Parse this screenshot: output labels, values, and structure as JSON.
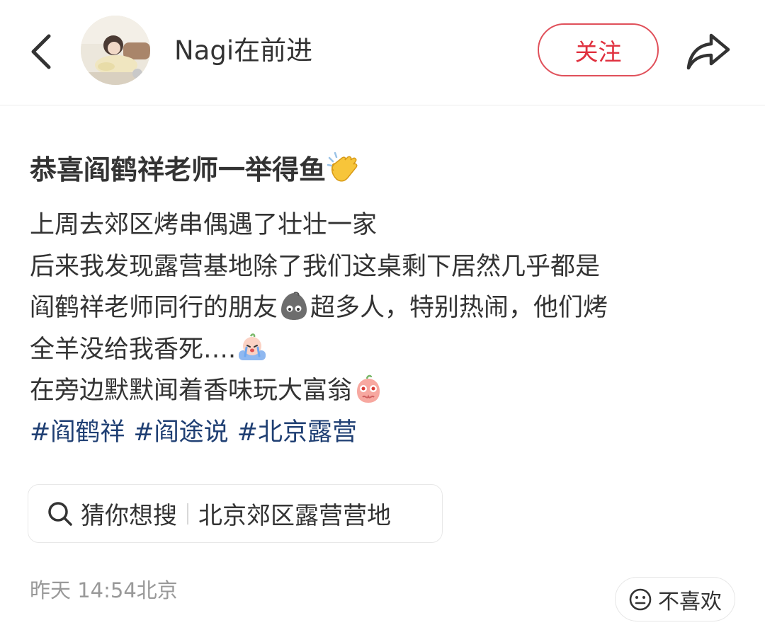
{
  "header": {
    "author_name": "Nagi在前进",
    "follow_label": "关注"
  },
  "post": {
    "title": "恭喜阎鹤祥老师一举得鱼",
    "lines": {
      "l1": "上周去郊区烤串偶遇了壮壮一家",
      "l2": "后来我发现露营基地除了我们这桌剩下居然几乎都是",
      "l3a": "阎鹤祥老师同行的朋友",
      "l3b": "超多人，特别热闹，他们烤",
      "l4": "全羊没给我香死….",
      "l5": "在旁边默默闻着香味玩大富翁"
    },
    "hashtags": [
      "#阎鹤祥",
      "#阎途说",
      "#北京露营"
    ]
  },
  "search_suggest": {
    "label": "猜你想搜",
    "term": "北京郊区露营营地"
  },
  "footer": {
    "meta": "昨天 14:54北京",
    "dislike_label": "不喜欢"
  },
  "icons": {
    "back": "chevron-left-icon",
    "share": "share-arrow-icon",
    "search": "search-icon",
    "dislike": "neutral-face-icon",
    "title_emoji": "clapping-hands-emoji",
    "emoji_1": "gray-blob-emoji",
    "emoji_2": "crying-emoji",
    "emoji_3": "pleading-emoji"
  },
  "colors": {
    "follow_accent": "#e0303e",
    "hashtag": "#1f3f73",
    "meta_text": "#999999"
  }
}
